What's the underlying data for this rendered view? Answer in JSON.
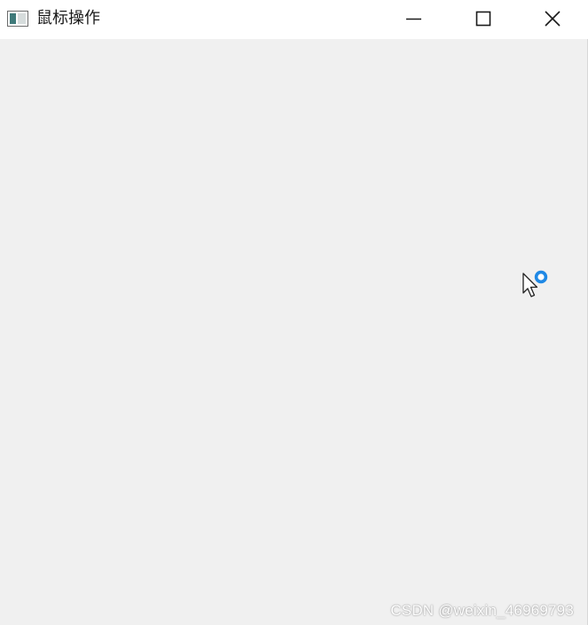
{
  "window": {
    "title": "鼠标操作",
    "controls": {
      "minimize_icon": "minimize-icon",
      "maximize_icon": "maximize-icon",
      "close_icon": "close-icon"
    }
  },
  "cursor": {
    "icon": "busy-arrow-cursor-icon",
    "accent_color": "#1e88e5"
  },
  "watermark": {
    "text": "CSDN @weixin_46969793"
  },
  "colors": {
    "titlebar_bg": "#ffffff",
    "client_bg": "#f0f0f0"
  }
}
